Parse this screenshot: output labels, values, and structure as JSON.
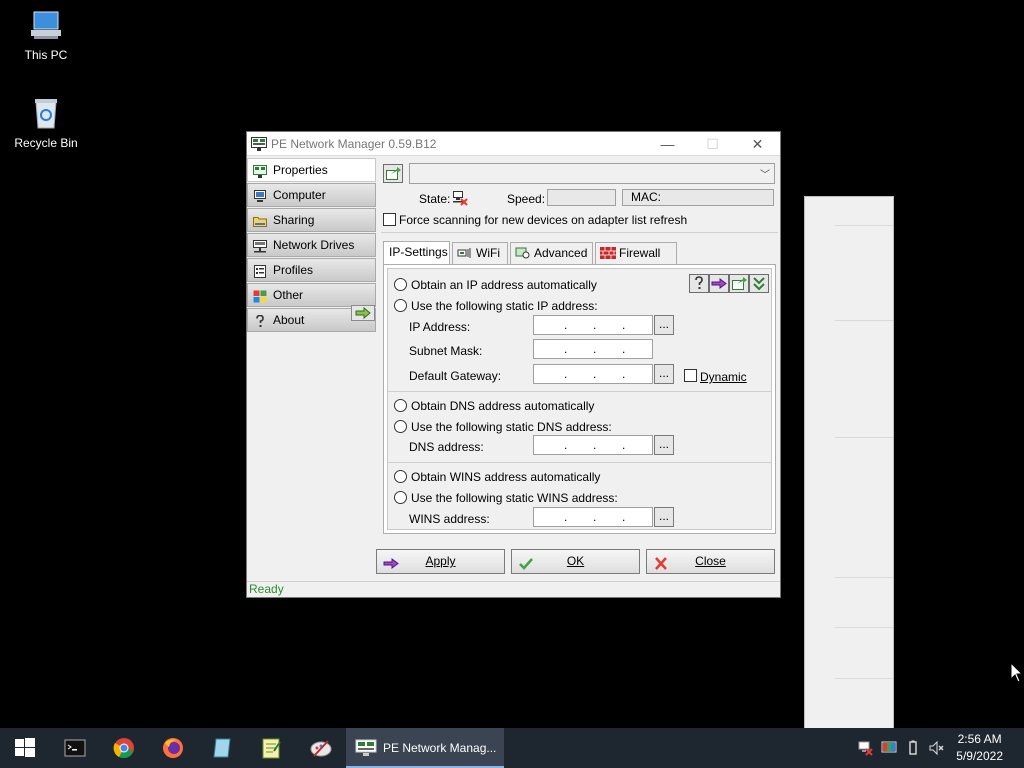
{
  "desktop": {
    "icons": [
      {
        "label": "This PC"
      },
      {
        "label": "Recycle Bin"
      }
    ]
  },
  "window": {
    "title": "PE Network Manager 0.59.B12",
    "controls": {
      "minimize": "—",
      "maximize": "☐",
      "close": "✕"
    }
  },
  "nav": {
    "items": [
      {
        "label": "Properties",
        "active": true
      },
      {
        "label": "Computer"
      },
      {
        "label": "Sharing"
      },
      {
        "label": "Network Drives"
      },
      {
        "label": "Profiles"
      },
      {
        "label": "Other"
      },
      {
        "label": "About"
      }
    ]
  },
  "adapter": {
    "selected": "",
    "state_label": "State:",
    "speed_label": "Speed:",
    "speed_value": "",
    "mac_label": "MAC:",
    "mac_value": "",
    "force_scan_label": "Force scanning for new devices on adapter list refresh"
  },
  "tabs": [
    {
      "label": "IP-Settings",
      "active": true
    },
    {
      "label": "WiFi"
    },
    {
      "label": "Advanced"
    },
    {
      "label": "Firewall"
    }
  ],
  "ip_settings": {
    "obtain_ip_auto": "Obtain an IP address automatically",
    "use_static_ip": "Use the following static IP address:",
    "ip_address_label": "IP Address:",
    "subnet_mask_label": "Subnet Mask:",
    "default_gateway_label": "Default Gateway:",
    "dynamic_label": "Dynamic",
    "obtain_dns_auto": "Obtain DNS address automatically",
    "use_static_dns": "Use the following static DNS address:",
    "dns_address_label": "DNS address:",
    "obtain_wins_auto": "Obtain WINS address automatically",
    "use_static_wins": "Use the following static WINS address:",
    "wins_address_label": "WINS address:",
    "browse_label": "...",
    "dot": "."
  },
  "buttons": {
    "apply": "Apply",
    "ok": "OK",
    "close": "Close"
  },
  "status": "Ready",
  "taskbar": {
    "active_app": "PE Network Manag...",
    "time": "2:56 AM",
    "date": "5/9/2022"
  }
}
